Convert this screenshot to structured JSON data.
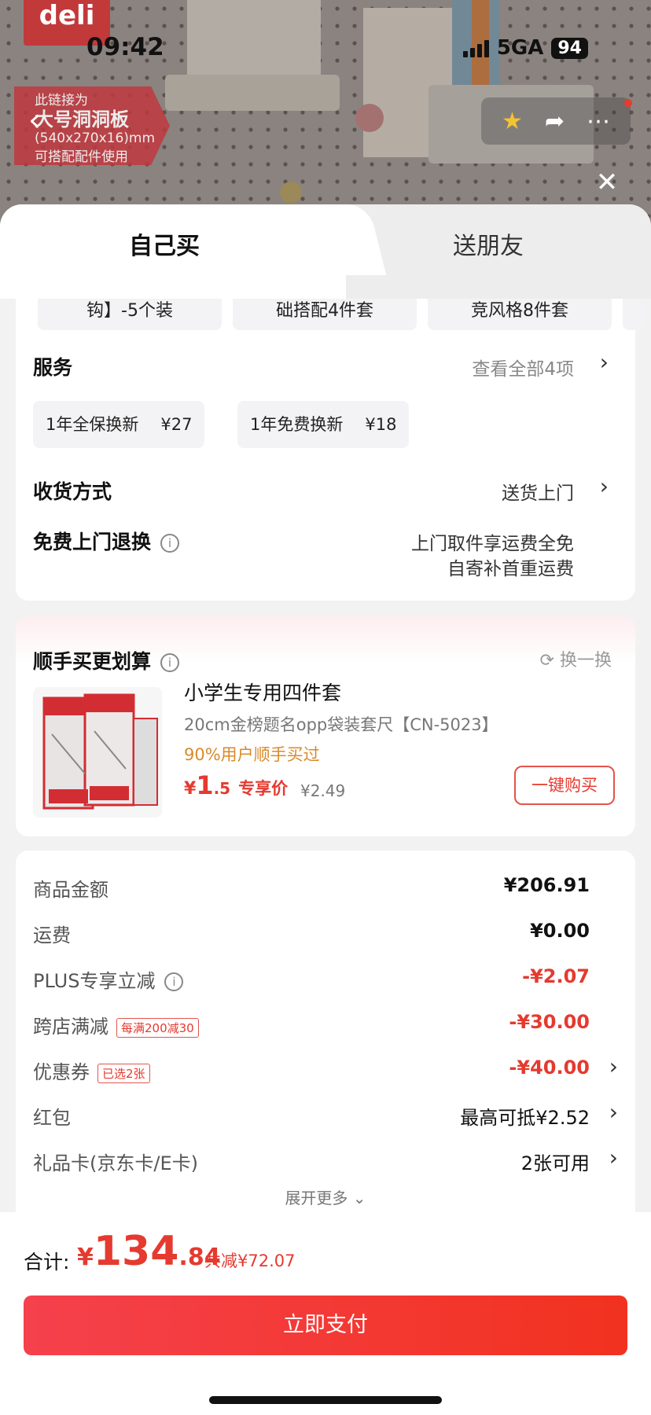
{
  "status_bar": {
    "time": "09:42",
    "network": "5GA",
    "battery": "94"
  },
  "background": {
    "brand": "deli",
    "promo_ribbon": {
      "line1": "此链接为",
      "line2": "大号洞洞板",
      "line3": "(540x270x16)mm",
      "line4": "可搭配配件使用"
    },
    "header_icons": [
      "back-arrow-icon",
      "star-icon",
      "share-icon",
      "more-icon",
      "close-icon"
    ],
    "accent_star_color": "#f3c332"
  },
  "tabs": [
    {
      "label": "自己买",
      "active": true
    },
    {
      "label": "送朋友",
      "active": false
    }
  ],
  "options_chips": [
    "钩】-5个装",
    "础搭配4件套",
    "竞风格8件套"
  ],
  "service": {
    "label": "服务",
    "see_all": "查看全部4项",
    "chips": [
      {
        "name": "1年全保换新",
        "price": "¥27"
      },
      {
        "name": "1年免费换新",
        "price": "¥18"
      }
    ]
  },
  "delivery": {
    "label": "收货方式",
    "value": "送货上门"
  },
  "free_return": {
    "label": "免费上门退换",
    "line1": "上门取件享运费全免",
    "line2": "自寄补首重运费"
  },
  "add_on": {
    "title": "顺手买更划算",
    "swap": "换一换",
    "product": {
      "title": "小学生专用四件套",
      "subtitle": "20cm金榜题名opp袋装套尺【CN-5023】",
      "tag": "90%用户顺手买过",
      "price_yen": "¥",
      "price_int": "1",
      "price_dec": ".5",
      "price_label": "专享价",
      "old_price": "¥2.49",
      "button": "一键购买"
    }
  },
  "summary": {
    "goods": {
      "label": "商品金额",
      "value": "¥206.91"
    },
    "shipping": {
      "label": "运费",
      "value": "¥0.00"
    },
    "plus": {
      "label": "PLUS专享立减",
      "value": "-¥2.07"
    },
    "cross_store": {
      "label": "跨店满减",
      "tag": "每满200减30",
      "value": "-¥30.00"
    },
    "coupon": {
      "label": "优惠券",
      "tag": "已选2张",
      "value": "-¥40.00"
    },
    "red_packet": {
      "label": "红包",
      "value": "最高可抵¥2.52"
    },
    "gift_card": {
      "label": "礼品卡(京东卡/E卡)",
      "value": "2张可用"
    },
    "expand": "展开更多"
  },
  "footer": {
    "total_label": "合计:",
    "total_yen": "¥",
    "total_int": "134",
    "total_dec": ".84",
    "total_save": "共减¥72.07",
    "pay_button": "立即支付"
  },
  "colors": {
    "accent_red": "#e53a2f",
    "gold_tag": "#d98a2a",
    "pay_gradient_start": "#f5414d",
    "pay_gradient_end": "#f2321f"
  }
}
